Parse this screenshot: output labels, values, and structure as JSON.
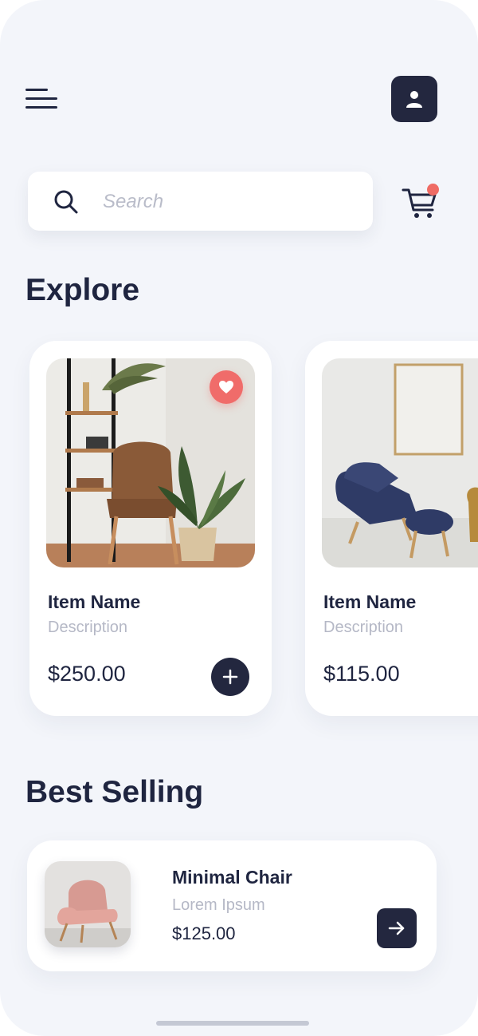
{
  "header": {
    "menu_icon": "hamburger-menu-icon",
    "profile_icon": "user-icon"
  },
  "search": {
    "placeholder": "Search",
    "icon": "search-icon"
  },
  "cart": {
    "icon": "shopping-cart-icon",
    "has_notification": true,
    "notification_color": "#ef6b64"
  },
  "explore": {
    "title": "Explore",
    "items": [
      {
        "name": "Item Name",
        "description": "Description",
        "price": "$250.00",
        "favorited": true
      },
      {
        "name": "Item Name",
        "description": "Description",
        "price": "$115.00"
      }
    ]
  },
  "best_selling": {
    "title": "Best Selling",
    "item": {
      "name": "Minimal Chair",
      "subtitle": "Lorem Ipsum",
      "price": "$125.00"
    }
  },
  "colors": {
    "background": "#f3f5fa",
    "primary_dark": "#23273f",
    "accent": "#f06c6a",
    "muted_text": "#b5b8c6"
  }
}
